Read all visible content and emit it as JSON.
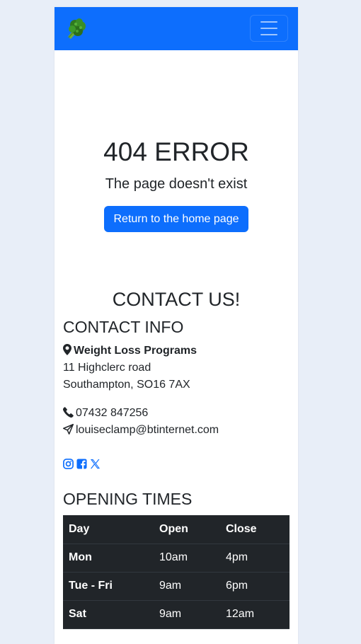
{
  "navbar": {
    "logo_icon": "broccoli-icon",
    "menu_icon": "hamburger-menu-icon",
    "brand_color": "#0d6efd"
  },
  "error": {
    "title": "404 ERROR",
    "subtitle": "The page doesn't exist",
    "button_label": "Return to the home page"
  },
  "contact": {
    "heading": "CONTACT US!",
    "info_heading": "CONTACT INFO",
    "business_name": "Weight Loss Programs",
    "address_line1": "11 Highclerc road",
    "address_line2": "Southampton, SO16 7AX",
    "phone": "07432 847256",
    "email": "louiseclamp@btinternet.com",
    "social": [
      "instagram-icon",
      "facebook-icon",
      "x-twitter-icon"
    ],
    "link_color": "#0d6efd"
  },
  "opening": {
    "heading": "OPENING TIMES",
    "columns": [
      "Day",
      "Open",
      "Close"
    ],
    "rows": [
      [
        "Mon",
        "10am",
        "4pm"
      ],
      [
        "Tue - Fri",
        "9am",
        "6pm"
      ],
      [
        "Sat",
        "9am",
        "12am"
      ]
    ],
    "table_bg": "#212529"
  }
}
